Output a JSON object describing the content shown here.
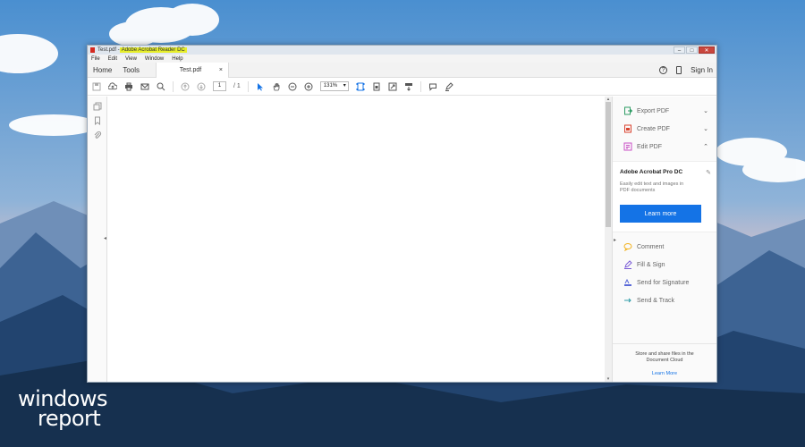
{
  "window": {
    "title_file": "Test.pdf - ",
    "title_app": "Adobe Acrobat Reader DC",
    "controls": {
      "minimize": "–",
      "maximize": "□",
      "close": "✕"
    }
  },
  "menu": [
    "File",
    "Edit",
    "View",
    "Window",
    "Help"
  ],
  "tabs": {
    "home": "Home",
    "tools": "Tools",
    "document": "Test.pdf",
    "close": "×"
  },
  "account": {
    "help": "?",
    "sign_in": "Sign In"
  },
  "toolbar": {
    "page_current": "1",
    "page_total": "/ 1",
    "zoom": "131%"
  },
  "tools": [
    {
      "label": "Export PDF",
      "icon": "export-pdf-icon",
      "color": "#2e9c64"
    },
    {
      "label": "Create PDF",
      "icon": "create-pdf-icon",
      "color": "#d9432f"
    },
    {
      "label": "Edit PDF",
      "icon": "edit-pdf-icon",
      "color": "#c950c5"
    }
  ],
  "promo": {
    "title": "Adobe Acrobat Pro DC",
    "desc": "Easily edit text and images in PDF documents",
    "button": "Learn more"
  },
  "tools_more": [
    {
      "label": "Comment",
      "icon": "comment-icon",
      "color": "#f2b21e"
    },
    {
      "label": "Fill & Sign",
      "icon": "fill-sign-icon",
      "color": "#7a5bd6"
    },
    {
      "label": "Send for Signature",
      "icon": "send-signature-icon",
      "color": "#5a6ad8"
    },
    {
      "label": "Send & Track",
      "icon": "send-track-icon",
      "color": "#2e9ca8"
    }
  ],
  "cloud": {
    "text": "Store and share files in the Document Cloud",
    "link": "Learn More"
  },
  "brand": {
    "line1": "windows",
    "line2": "report"
  },
  "colors": {
    "accent": "#1473e6",
    "title_highlight": "#e7ee2b"
  }
}
